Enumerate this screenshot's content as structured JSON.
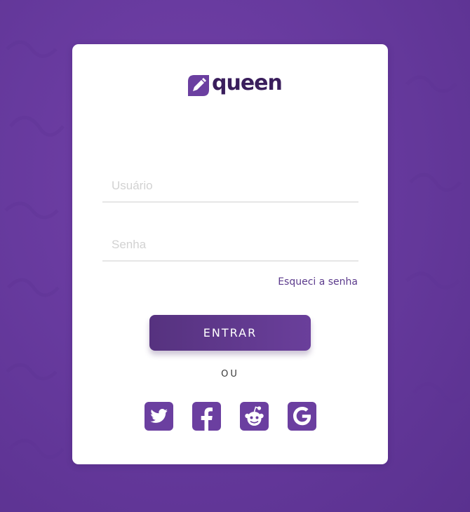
{
  "brand": {
    "name": "queen",
    "logo_icon": "pencil-tag-icon",
    "color": "#6b3fa0",
    "text_color": "#3a1e5c"
  },
  "login": {
    "username_placeholder": "Usuário",
    "password_placeholder": "Senha",
    "forgot_label": "Esqueci a senha",
    "submit_label": "ENTRAR",
    "divider_label": "OU"
  },
  "social": [
    {
      "name": "twitter",
      "icon": "twitter-icon"
    },
    {
      "name": "facebook",
      "icon": "facebook-icon"
    },
    {
      "name": "reddit",
      "icon": "reddit-icon"
    },
    {
      "name": "google",
      "icon": "google-icon"
    }
  ],
  "colors": {
    "background": "#6a3ba0",
    "accent": "#6b3fa0",
    "button_start": "#56327f",
    "button_end": "#6a3f9b",
    "input_border": "#e6e6e6"
  }
}
